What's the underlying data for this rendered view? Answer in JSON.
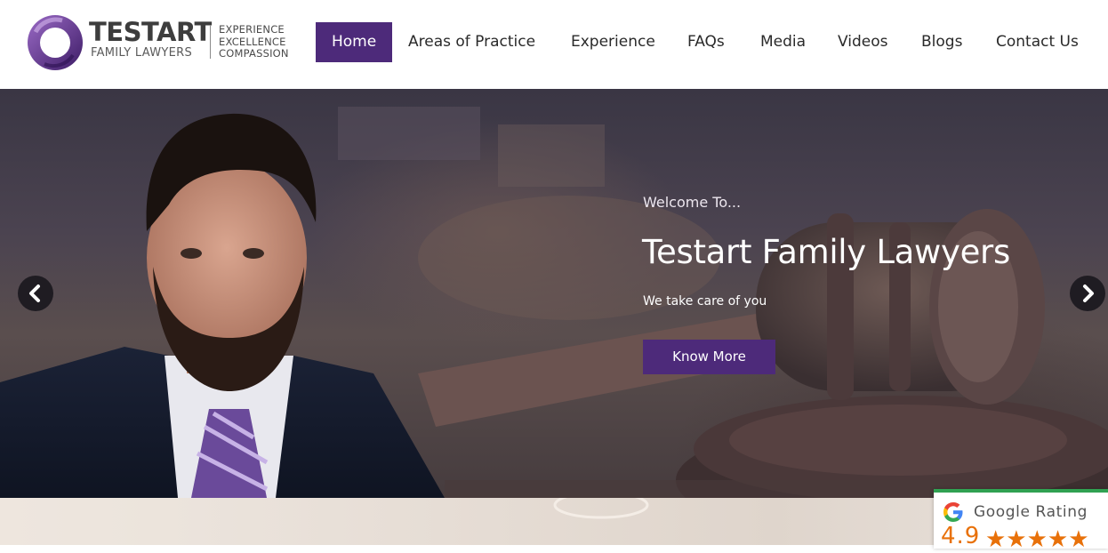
{
  "brand": {
    "name": "TESTART",
    "subtitle": "FAMILY LAWYERS",
    "tagline": [
      "EXPERIENCE",
      "EXCELLENCE",
      "COMPASSION"
    ],
    "accent": "#4d2a7a"
  },
  "nav": {
    "items": [
      {
        "label": "Home",
        "active": true
      },
      {
        "label": "Areas of Practice",
        "active": false
      },
      {
        "label": "Experience",
        "active": false
      },
      {
        "label": "FAQs",
        "active": false
      },
      {
        "label": "Media",
        "active": false
      },
      {
        "label": "Videos",
        "active": false
      },
      {
        "label": "Blogs",
        "active": false
      },
      {
        "label": "Contact Us",
        "active": false
      }
    ]
  },
  "hero": {
    "pre_title": "Welcome To...",
    "title": "Testart Family Lawyers",
    "subtitle": "We take care of you",
    "button_label": "Know More",
    "prev_icon": "chevron-left-icon",
    "next_icon": "chevron-right-icon"
  },
  "rating": {
    "label": "Google Rating",
    "score": "4.9",
    "stars": "★★★★★",
    "icon": "google-g-icon",
    "star_color": "#e8710a",
    "bar_color": "#30a152"
  }
}
